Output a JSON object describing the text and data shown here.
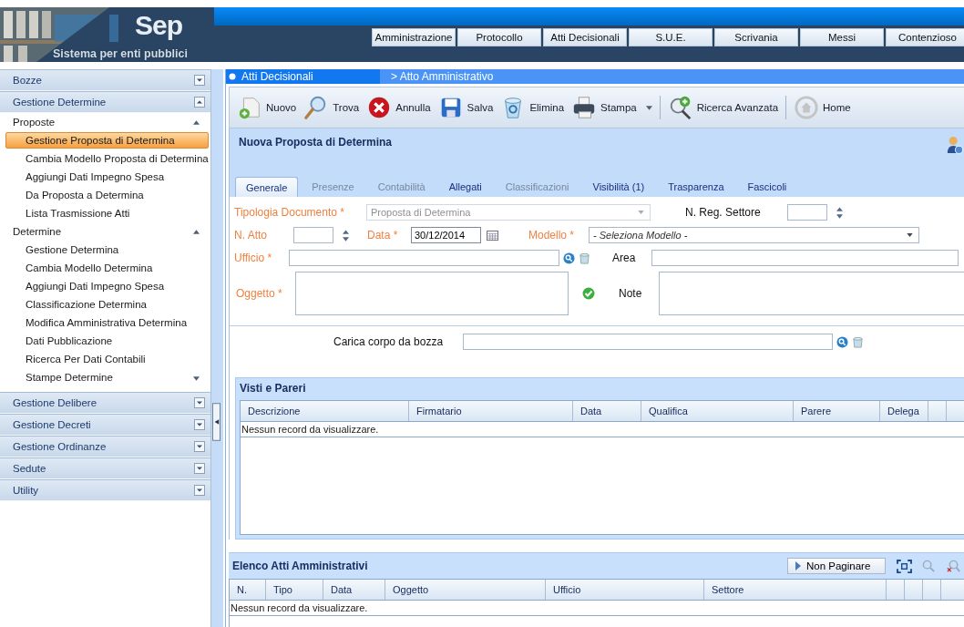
{
  "header": {
    "logo": {
      "title": "Sep",
      "subtitle": "Sistema per enti pubblici"
    },
    "nav": [
      {
        "label": "Amministrazione"
      },
      {
        "label": "Protocollo"
      },
      {
        "label": "Atti Decisionali"
      },
      {
        "label": "S.U.E."
      },
      {
        "label": "Scrivania"
      },
      {
        "label": "Messi"
      },
      {
        "label": "Contenzioso"
      }
    ]
  },
  "sidebar": {
    "sections": [
      {
        "label": "Bozze",
        "expanded": false
      },
      {
        "label": "Gestione Determine",
        "expanded": true,
        "groups": [
          {
            "label": "Proposte",
            "expanded": true,
            "items": [
              {
                "label": "Gestione Proposta di Determina",
                "selected": true
              },
              {
                "label": "Cambia Modello Proposta di Determina",
                "selected": false
              },
              {
                "label": "Aggiungi Dati Impegno Spesa",
                "selected": false
              },
              {
                "label": "Da Proposta a Determina",
                "selected": false
              },
              {
                "label": "Lista Trasmissione Atti",
                "selected": false
              }
            ]
          },
          {
            "label": "Determine",
            "expanded": true,
            "items": [
              {
                "label": "Gestione Determina",
                "selected": false
              },
              {
                "label": "Cambia Modello Determina",
                "selected": false
              },
              {
                "label": "Aggiungi Dati Impegno Spesa",
                "selected": false
              },
              {
                "label": "Classificazione Determina",
                "selected": false
              },
              {
                "label": "Modifica Amministrativa Determina",
                "selected": false
              },
              {
                "label": "Dati Pubblicazione",
                "selected": false
              },
              {
                "label": "Ricerca Per Dati Contabili",
                "selected": false
              },
              {
                "label": "Stampe Determine",
                "selected": false
              }
            ]
          }
        ]
      },
      {
        "label": "Gestione Delibere",
        "expanded": false
      },
      {
        "label": "Gestione Decreti",
        "expanded": false
      },
      {
        "label": "Gestione Ordinanze",
        "expanded": false
      },
      {
        "label": "Sedute",
        "expanded": false
      },
      {
        "label": "Utility",
        "expanded": false
      }
    ]
  },
  "breadcrumb": [
    {
      "label": "Atti Decisionali"
    },
    {
      "label": "> Atto Amministrativo"
    }
  ],
  "toolbar": [
    {
      "label": "Nuovo",
      "kind": "new"
    },
    {
      "label": "Trova",
      "kind": "find"
    },
    {
      "label": "Annulla",
      "kind": "cancel"
    },
    {
      "label": "Salva",
      "kind": "save"
    },
    {
      "label": "Elimina",
      "kind": "delete"
    },
    {
      "label": "Stampa",
      "kind": "print"
    },
    {
      "label": "Ricerca Avanzata",
      "kind": "advanced"
    },
    {
      "label": "Home",
      "kind": "home"
    }
  ],
  "form": {
    "title": "Nuova Proposta di Determina",
    "tabs": [
      {
        "label": "Generale",
        "selected": true,
        "disabled": false
      },
      {
        "label": "Presenze",
        "selected": false,
        "disabled": true
      },
      {
        "label": "Contabilità",
        "selected": false,
        "disabled": true
      },
      {
        "label": "Allegati",
        "selected": false,
        "disabled": false
      },
      {
        "label": "Classificazioni",
        "selected": false,
        "disabled": true
      },
      {
        "label": "Visibilità (1)",
        "selected": false,
        "disabled": false
      },
      {
        "label": "Trasparenza",
        "selected": false,
        "disabled": false
      },
      {
        "label": "Fascicoli",
        "selected": false,
        "disabled": false
      }
    ],
    "tipologia": {
      "label": "Tipologia Documento *",
      "required": true,
      "value": "Proposta di Determina",
      "disabled": true
    },
    "reg_settore": {
      "label": "N. Reg. Settore",
      "required": false
    },
    "n_atto": {
      "label": "N. Atto",
      "required": true
    },
    "data": {
      "label": "Data *",
      "required": true,
      "value": "30/12/2014"
    },
    "modello": {
      "label": "Modello *",
      "required": true,
      "value": "- Seleziona Modello -"
    },
    "ufficio": {
      "label": "Ufficio *",
      "required": true
    },
    "area": {
      "label": "Area",
      "required": false
    },
    "oggetto": {
      "label": "Oggetto *",
      "required": true
    },
    "note": {
      "label": "Note",
      "required": false
    },
    "bozza": {
      "label": "Carica corpo da bozza",
      "required": false
    }
  },
  "visti": {
    "title": "Visti e Pareri",
    "columns": [
      "Descrizione",
      "Firmatario",
      "Data",
      "Qualifica",
      "Parere",
      "Delega"
    ],
    "empty": "Nessun record da visualizzare."
  },
  "elenco": {
    "title": "Elenco Atti Amministrativi",
    "button": "Non Paginare",
    "columns": [
      "N.",
      "Tipo",
      "Data",
      "Oggetto",
      "Ufficio",
      "Settore"
    ],
    "empty": "Nessun record da visualizzare."
  }
}
